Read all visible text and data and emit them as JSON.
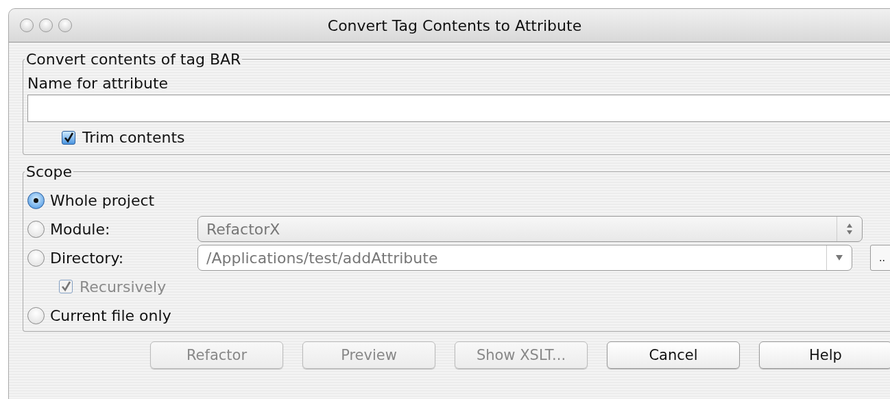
{
  "window": {
    "title": "Convert Tag Contents to Attribute"
  },
  "name_group": {
    "legend": "Convert contents of tag BAR",
    "label": "Name for attribute",
    "trim": {
      "label": "Trim contents",
      "checked": true
    }
  },
  "scope": {
    "legend": "Scope",
    "options": [
      {
        "kind": "radio",
        "label": "Whole project",
        "selected": true
      },
      {
        "kind": "radio",
        "label": "Module:",
        "selected": false,
        "combo": {
          "kind": "spinner",
          "value": "RefactorX",
          "disabled": true
        }
      },
      {
        "kind": "radio",
        "label": "Directory:",
        "selected": false,
        "combo": {
          "kind": "dropdown",
          "value": "/Applications/test/addAttribute",
          "disabled": false
        },
        "browse": ".."
      },
      {
        "kind": "checkbox",
        "label": "Recursively",
        "checked": true,
        "disabled": true
      },
      {
        "kind": "radio",
        "label": "Current file only",
        "selected": false
      }
    ]
  },
  "buttons": [
    {
      "label": "Refactor",
      "disabled": true
    },
    {
      "label": "Preview",
      "disabled": true
    },
    {
      "label": "Show XSLT...",
      "disabled": true
    },
    {
      "label": "Cancel",
      "disabled": false
    },
    {
      "label": "Help",
      "disabled": false
    }
  ]
}
